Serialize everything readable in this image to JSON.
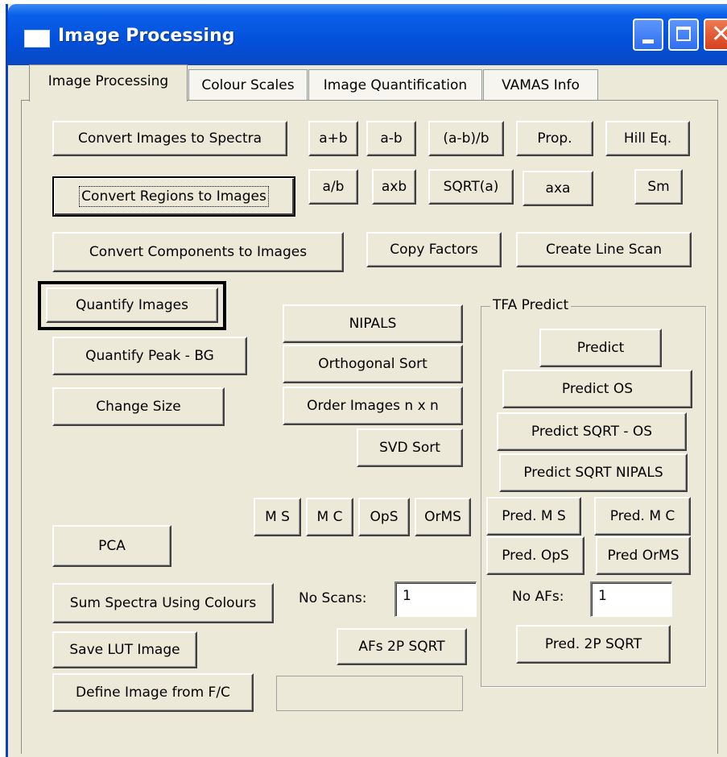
{
  "window": {
    "title": "Image Processing"
  },
  "tabs": [
    "Image Processing",
    "Colour Scales",
    "Image Quantification",
    "VAMAS Info"
  ],
  "buttons": {
    "convert_images_to_spectra": "Convert Images to Spectra",
    "convert_regions_to_images": "Convert Regions to Images",
    "convert_components_to_images": "Convert Components to Images",
    "a_plus_b": "a+b",
    "a_minus_b": "a-b",
    "a_minus_b_over_b": "(a-b)/b",
    "prop": "Prop.",
    "hill_eq": "Hill Eq.",
    "a_over_b": "a/b",
    "a_times_b": "axb",
    "sqrt_a": "SQRT(a)",
    "a_times_a": "axa",
    "sm": "Sm",
    "copy_factors": "Copy Factors",
    "create_line_scan": "Create Line Scan",
    "quantify_images": "Quantify Images",
    "quantify_peak_bg": "Quantify Peak - BG",
    "change_size": "Change Size",
    "nipals": "NIPALS",
    "orthogonal_sort": "Orthogonal Sort",
    "order_images": "Order Images n x n",
    "svd_sort": "SVD Sort",
    "ms": "M S",
    "mc": "M C",
    "ops": "OpS",
    "orms": "OrMS",
    "pca": "PCA",
    "sum_spectra": "Sum Spectra Using Colours",
    "save_lut": "Save LUT Image",
    "define_image": "Define Image from F/C",
    "afs_2p_sqrt": "AFs 2P SQRT"
  },
  "tfa": {
    "label": "TFA Predict",
    "predict": "Predict",
    "predict_os": "Predict OS",
    "predict_sqrt_os": "Predict SQRT - OS",
    "predict_sqrt_nipals": "Predict SQRT NIPALS",
    "pred_ms": "Pred. M S",
    "pred_mc": "Pred. M C",
    "pred_ops": "Pred. OpS",
    "pred_orms": "Pred OrMS",
    "no_afs_label": "No AFs:",
    "no_afs_value": "1",
    "pred_2p_sqrt": "Pred. 2P SQRT"
  },
  "no_scans": {
    "label": "No Scans:",
    "value": "1"
  },
  "define_value": ""
}
